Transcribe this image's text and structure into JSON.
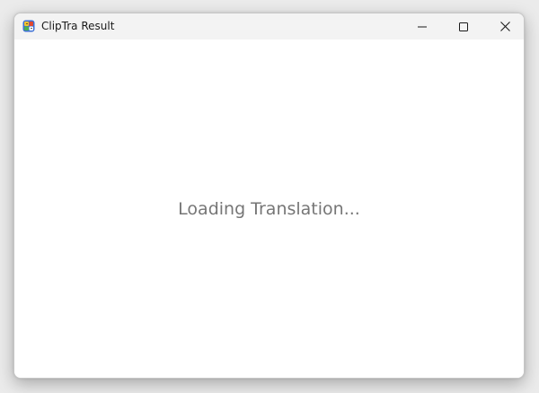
{
  "window": {
    "title": "ClipTra Result",
    "app_icon": "cliptra-app-icon",
    "controls": {
      "minimize_icon": "minimize-icon",
      "maximize_icon": "maximize-icon",
      "close_icon": "close-icon"
    }
  },
  "content": {
    "status_text": "Loading Translation..."
  },
  "colors": {
    "titlebar": "#f3f3f3",
    "content_bg": "#ffffff",
    "status_text": "#767676"
  }
}
